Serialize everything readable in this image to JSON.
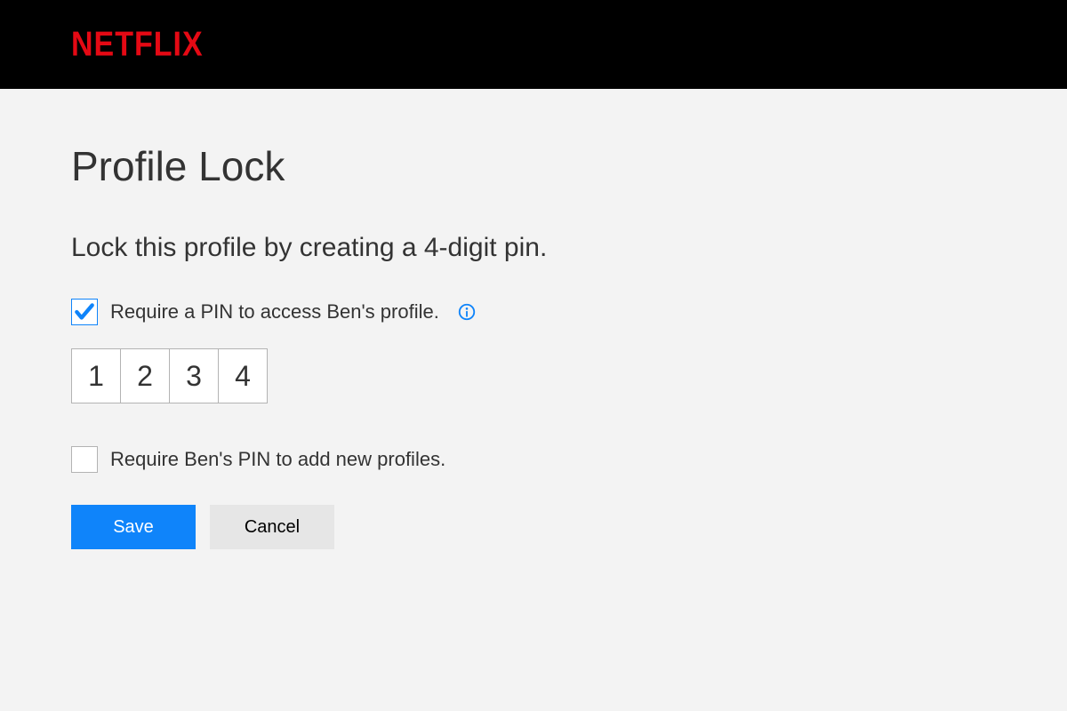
{
  "brand": {
    "name": "NETFLIX"
  },
  "page": {
    "title": "Profile Lock",
    "instruction": "Lock this profile by creating a 4-digit pin."
  },
  "checkboxes": {
    "requirePinAccess": {
      "label": "Require a PIN to access Ben's profile.",
      "checked": true
    },
    "requirePinAddProfile": {
      "label": "Require Ben's PIN to add new profiles.",
      "checked": false
    }
  },
  "pin": {
    "digits": [
      "1",
      "2",
      "3",
      "4"
    ]
  },
  "buttons": {
    "save": "Save",
    "cancel": "Cancel"
  },
  "colors": {
    "brand_red": "#e50914",
    "accent_blue": "#0f84fa"
  }
}
